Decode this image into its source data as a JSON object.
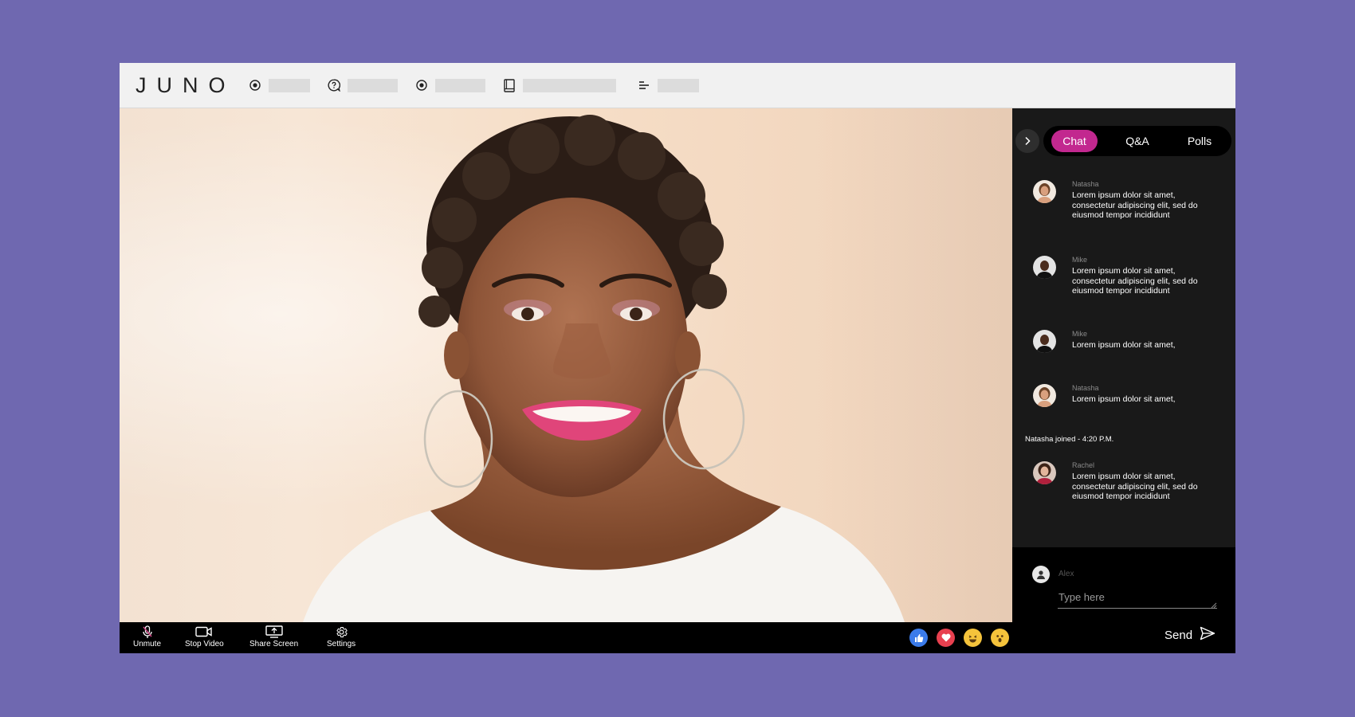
{
  "app": {
    "logo": "JUNO"
  },
  "colors": {
    "background": "#6f68b0",
    "accent": "#c2288f",
    "topbar": "#f1f1f1",
    "panel": "#191919"
  },
  "nav": [
    {
      "icon": "radio-icon"
    },
    {
      "icon": "question-icon"
    },
    {
      "icon": "radio-icon"
    },
    {
      "icon": "book-icon"
    },
    {
      "icon": "align-left-icon"
    }
  ],
  "controls": {
    "unmute": "Unmute",
    "stop_video": "Stop Video",
    "share_screen": "Share Screen",
    "settings": "Settings"
  },
  "reactions": [
    "thumbs-up-icon",
    "heart-icon",
    "laughing-icon",
    "surprised-icon"
  ],
  "panel": {
    "tabs": [
      "Chat",
      "Q&A",
      "Polls"
    ],
    "active_tab": "Chat",
    "messages": [
      {
        "name": "Natasha",
        "text": "Lorem ipsum dolor sit amet, consectetur adipiscing elit, sed do eiusmod tempor incididunt"
      },
      {
        "name": "Mike",
        "text": "Lorem ipsum dolor sit amet, consectetur adipiscing elit, sed do eiusmod tempor incididunt"
      },
      {
        "name": "Mike",
        "text": "Lorem ipsum dolor sit amet,"
      },
      {
        "name": "Natasha",
        "text": "Lorem ipsum dolor sit amet,"
      },
      {
        "name": "Rachel",
        "text": "Lorem ipsum dolor sit amet, consectetur adipiscing elit, sed do eiusmod tempor incididunt"
      }
    ],
    "system_message": "Natasha joined - 4:20 P.M."
  },
  "compose": {
    "user": "Alex",
    "placeholder": "Type here",
    "send_label": "Send"
  }
}
